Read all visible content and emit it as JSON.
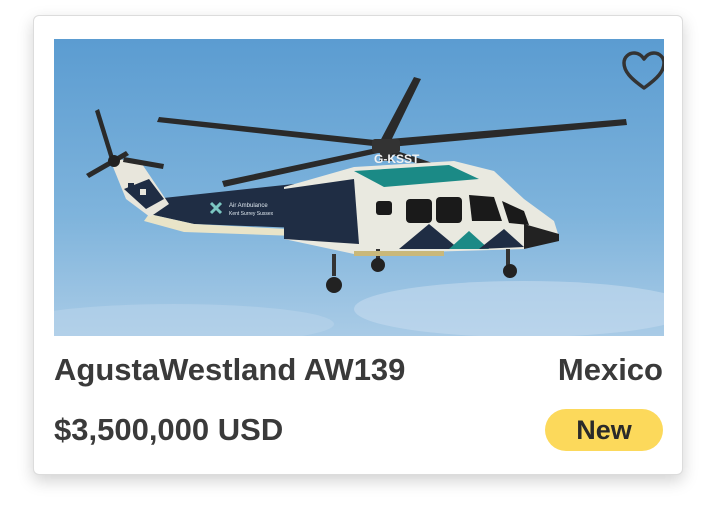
{
  "listing": {
    "title": "AgustaWestland AW139",
    "location": "Mexico",
    "price": "$3,500,000 USD",
    "condition_badge": "New",
    "image": {
      "registration": "G-KSST",
      "livery_text_1": "Air Ambulance",
      "livery_text_2": "Kent Surrey Sussex"
    },
    "favorite_icon": "heart-outline-icon"
  },
  "colors": {
    "badge_bg": "#fcd95b",
    "text": "#3a3a3a",
    "sky": "#6fa9d6"
  }
}
